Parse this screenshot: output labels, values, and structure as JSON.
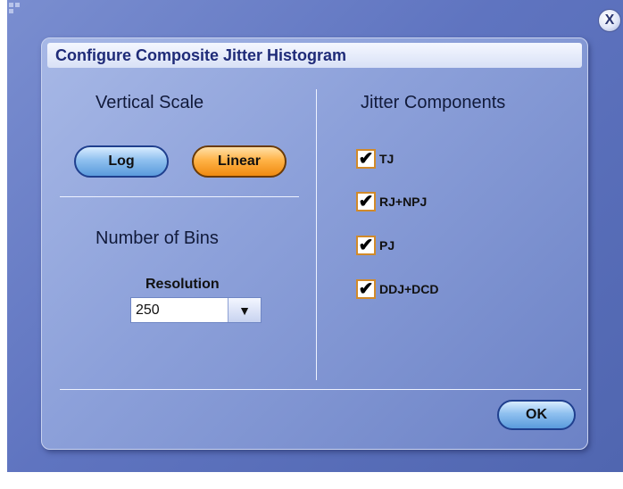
{
  "dialog": {
    "title": "Configure Composite Jitter Histogram",
    "close_glyph": "X"
  },
  "vertical_scale": {
    "heading": "Vertical Scale",
    "log_label": "Log",
    "linear_label": "Linear",
    "selected": "Linear"
  },
  "bins": {
    "heading": "Number of Bins",
    "resolution_label": "Resolution",
    "resolution_value": "250",
    "dropdown_glyph": "▼"
  },
  "jitter": {
    "heading": "Jitter Components",
    "items": [
      {
        "label": "TJ",
        "checked": true
      },
      {
        "label": "RJ+NPJ",
        "checked": true
      },
      {
        "label": "PJ",
        "checked": true
      },
      {
        "label": "DDJ+DCD",
        "checked": true
      }
    ],
    "check_glyph": "✔"
  },
  "footer": {
    "ok_label": "OK"
  },
  "colors": {
    "window_bg": "#5f74c0",
    "dialog_bg": "#8da1da",
    "title_text": "#1f2b78",
    "blue_button": "#8fc0ef",
    "orange_button": "#ffb347",
    "checkbox_border": "#d18a2a"
  }
}
